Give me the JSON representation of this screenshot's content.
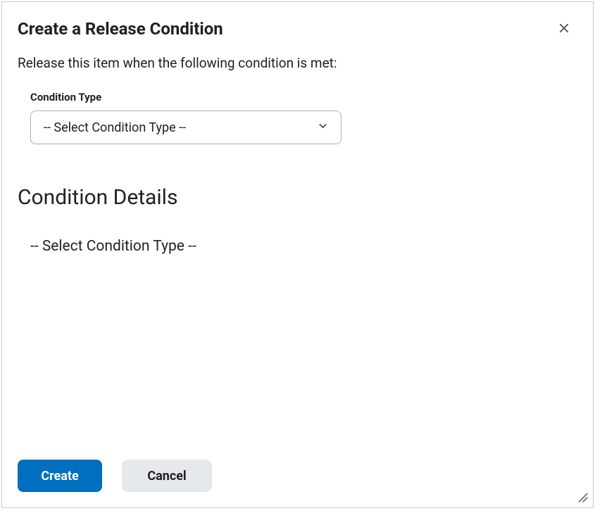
{
  "dialog": {
    "title": "Create a Release Condition",
    "instruction": "Release this item when the following condition is met:",
    "close_icon": "close"
  },
  "condition_type": {
    "label": "Condition Type",
    "selected": "-- Select Condition Type --"
  },
  "details": {
    "heading": "Condition Details",
    "placeholder": "-- Select Condition Type --"
  },
  "footer": {
    "create_label": "Create",
    "cancel_label": "Cancel"
  }
}
